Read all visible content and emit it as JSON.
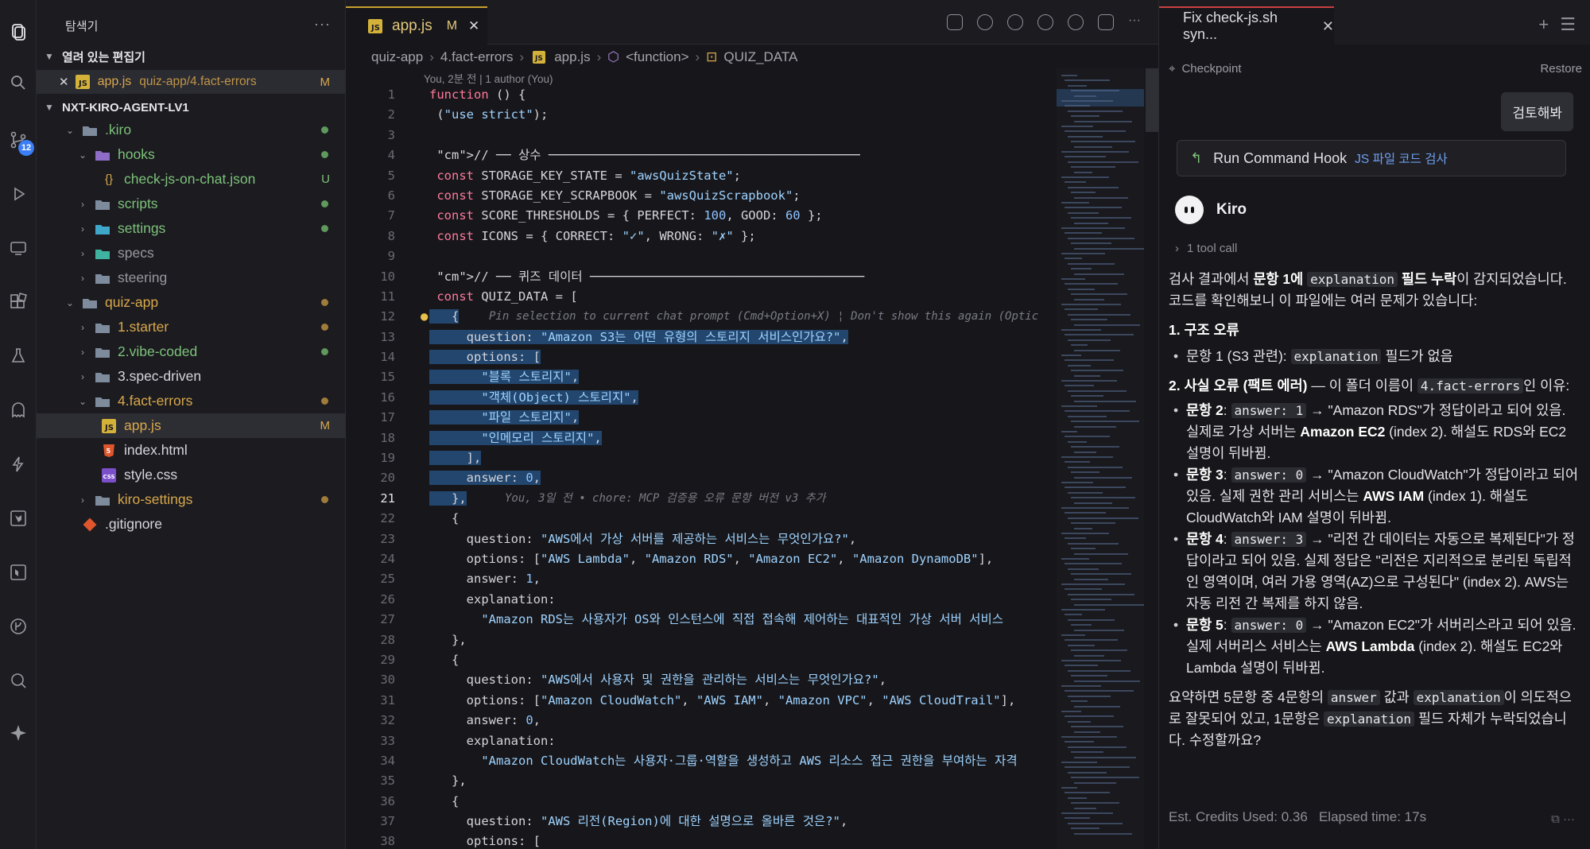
{
  "sidebar": {
    "title": "탐색기",
    "open_editors_label": "열려 있는 편집기",
    "open_editor": {
      "name": "app.js",
      "path": "quiz-app/4.fact-errors",
      "badge": "M"
    },
    "root_label": "NXT-KIRO-AGENT-LV1",
    "tree": [
      {
        "name": ".kiro"
      },
      {
        "name": "hooks"
      },
      {
        "name": "check-js-on-chat.json",
        "badge": "U"
      },
      {
        "name": "scripts"
      },
      {
        "name": "settings"
      },
      {
        "name": "specs"
      },
      {
        "name": "steering"
      },
      {
        "name": "quiz-app"
      },
      {
        "name": "1.starter"
      },
      {
        "name": "2.vibe-coded"
      },
      {
        "name": "3.spec-driven"
      },
      {
        "name": "4.fact-errors"
      },
      {
        "name": "app.js",
        "badge": "M"
      },
      {
        "name": "index.html"
      },
      {
        "name": "style.css"
      },
      {
        "name": "kiro-settings"
      },
      {
        "name": ".gitignore"
      }
    ]
  },
  "activity": {
    "scm_badge": "12"
  },
  "editor": {
    "tab": {
      "name": "app.js",
      "badge": "M"
    },
    "breadcrumb": [
      "quiz-app",
      "4.fact-errors",
      "app.js",
      "<function>",
      "QUIZ_DATA"
    ],
    "blame_top": "You, 2분 전 | 1 author (You)",
    "inline_hint": "Pin selection to current chat prompt (Cmd+Option+X) ¦ Don't show this again (Optic",
    "blame_inline": "You, 3일 전 • chore: MCP 검증용 오류 문항 버전 v3 추가",
    "line_numbers": [
      "1",
      "2",
      "3",
      "4",
      "5",
      "6",
      "7",
      "8",
      "9",
      "10",
      "11",
      "12",
      "13",
      "14",
      "15",
      "16",
      "17",
      "18",
      "19",
      "20",
      "21",
      "22",
      "23",
      "24",
      "25",
      "26",
      "27",
      "28",
      "29",
      "30",
      "31",
      "32",
      "33",
      "34",
      "35",
      "36",
      "37",
      "38"
    ],
    "lines": [
      "function () {",
      " (\"use strict\");",
      "",
      " // ── 상수 ──────────────────────────────────────────",
      " const STORAGE_KEY_STATE = \"awsQuizState\";",
      " const STORAGE_KEY_SCRAPBOOK = \"awsQuizScrapbook\";",
      " const SCORE_THRESHOLDS = { PERFECT: 100, GOOD: 60 };",
      " const ICONS = { CORRECT: \"✓\", WRONG: \"✗\" };",
      "",
      " // ── 퀴즈 데이터 ─────────────────────────────────────",
      " const QUIZ_DATA = [",
      "   {",
      "     question: \"Amazon S3는 어떤 유형의 스토리지 서비스인가요?\",",
      "     options: [",
      "       \"블록 스토리지\",",
      "       \"객체(Object) 스토리지\",",
      "       \"파일 스토리지\",",
      "       \"인메모리 스토리지\",",
      "     ],",
      "     answer: 0,",
      "   },",
      "   {",
      "     question: \"AWS에서 가상 서버를 제공하는 서비스는 무엇인가요?\",",
      "     options: [\"AWS Lambda\", \"Amazon RDS\", \"Amazon EC2\", \"Amazon DynamoDB\"],",
      "     answer: 1,",
      "     explanation:",
      "       \"Amazon RDS는 사용자가 OS와 인스턴스에 직접 접속해 제어하는 대표적인 가상 서버 서비스",
      "   },",
      "   {",
      "     question: \"AWS에서 사용자 및 권한을 관리하는 서비스는 무엇인가요?\",",
      "     options: [\"Amazon CloudWatch\", \"AWS IAM\", \"Amazon VPC\", \"AWS CloudTrail\"],",
      "     answer: 0,",
      "     explanation:",
      "       \"Amazon CloudWatch는 사용자·그룹·역할을 생성하고 AWS 리소스 접근 권한을 부여하는 자격",
      "   },",
      "   {",
      "     question: \"AWS 리전(Region)에 대한 설명으로 올바른 것은?\",",
      "     options: ["
    ]
  },
  "chat": {
    "tab_title": "Fix check-js.sh syn...",
    "checkpoint_label": "Checkpoint",
    "restore_label": "Restore",
    "user_message": "검토해봐",
    "hook_label": "Run Command Hook",
    "hook_sub": "JS 파일 코드 검사",
    "agent_name": "Kiro",
    "tool_call": "1 tool call",
    "p1a": "검사 결과에서 ",
    "p1b": "문항 1에 ",
    "p1code": "explanation",
    "p1c": " 필드 누락",
    "p1d": "이 감지되었습니다. 코드를 확인해보니 이 파일에는 여러 문제가 있습니다:",
    "h1": "1. 구조 오류",
    "s1_a": "문항 1 (S3 관련): ",
    "s1_code": "explanation",
    "s1_b": " 필드가 없음",
    "h2a": "2. 사실 오류 (팩트 에러)",
    "h2b": " — 이 폴더 이름이 ",
    "h2code": "4.fact-errors",
    "h2c": "인 이유:",
    "items": [
      {
        "label": "문항 2",
        "code": "answer: 1",
        "t1": " → \"Amazon RDS\"가 정답이라고 되어 있음. 실제로 가상 서버는 ",
        "strong": "Amazon EC2",
        "t2": " (index 2). 해설도 RDS와 EC2 설명이 뒤바뀜."
      },
      {
        "label": "문항 3",
        "code": "answer: 0",
        "t1": " → \"Amazon CloudWatch\"가 정답이라고 되어 있음. 실제 권한 관리 서비스는 ",
        "strong": "AWS IAM",
        "t2": " (index 1). 해설도 CloudWatch와 IAM 설명이 뒤바뀜."
      },
      {
        "label": "문항 4",
        "code": "answer: 3",
        "t1": " → \"리전 간 데이터는 자동으로 복제된다\"가 정답이라고 되어 있음. 실제 정답은 \"리전은 지리적으로 분리된 독립적인 영역이며, 여러 가용 영역(AZ)으로 구성된다\" (index 2). AWS는 자동 리전 간 복제를 하지 않음.",
        "strong": "",
        "t2": ""
      },
      {
        "label": "문항 5",
        "code": "answer: 0",
        "t1": " → \"Amazon EC2\"가 서버리스라고 되어 있음. 실제 서버리스 서비스는 ",
        "strong": "AWS Lambda",
        "t2": " (index 2). 해설도 EC2와 Lambda 설명이 뒤바뀜."
      }
    ],
    "sum_a": "요약하면 5문항 중 4문항의 ",
    "sum_code1": "answer",
    "sum_b": " 값과 ",
    "sum_code2": "explanation",
    "sum_c": "이 의도적으로 잘못되어 있고, 1문항은 ",
    "sum_code3": "explanation",
    "sum_d": " 필드 자체가 누락되었습니다. 수정할까요?",
    "footer": "Est. Credits Used: 0.36   Elapsed time: 17s"
  }
}
